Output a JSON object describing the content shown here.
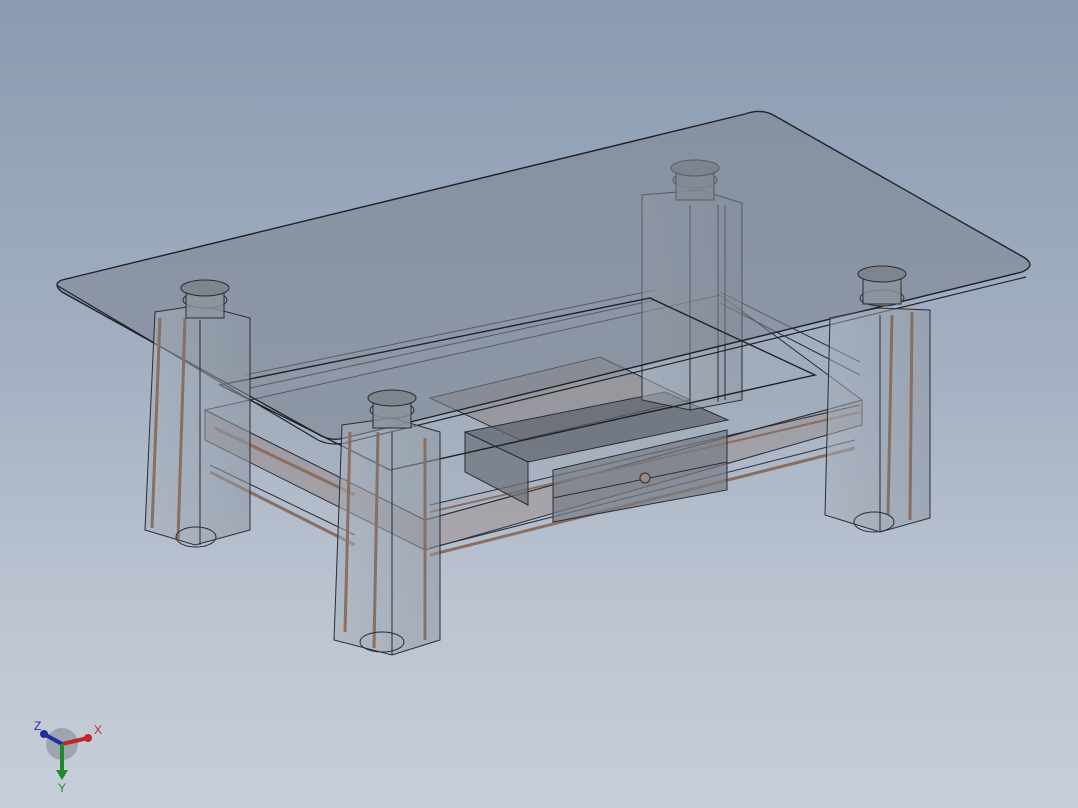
{
  "triad": {
    "x_label": "X",
    "y_label": "Y",
    "z_label": "Z",
    "x_color": "#c0262a",
    "y_color": "#1e8a2a",
    "z_color": "#1d2f9e"
  },
  "colors": {
    "glass_fill": "#7f8894",
    "edge": "#2a2d33",
    "leg_fill": "#9aa3af",
    "trim": "#8a6e60",
    "drawer_fill": "#6c7079",
    "background_top": "#8a9bb1",
    "background_bottom": "#c8ced9"
  }
}
